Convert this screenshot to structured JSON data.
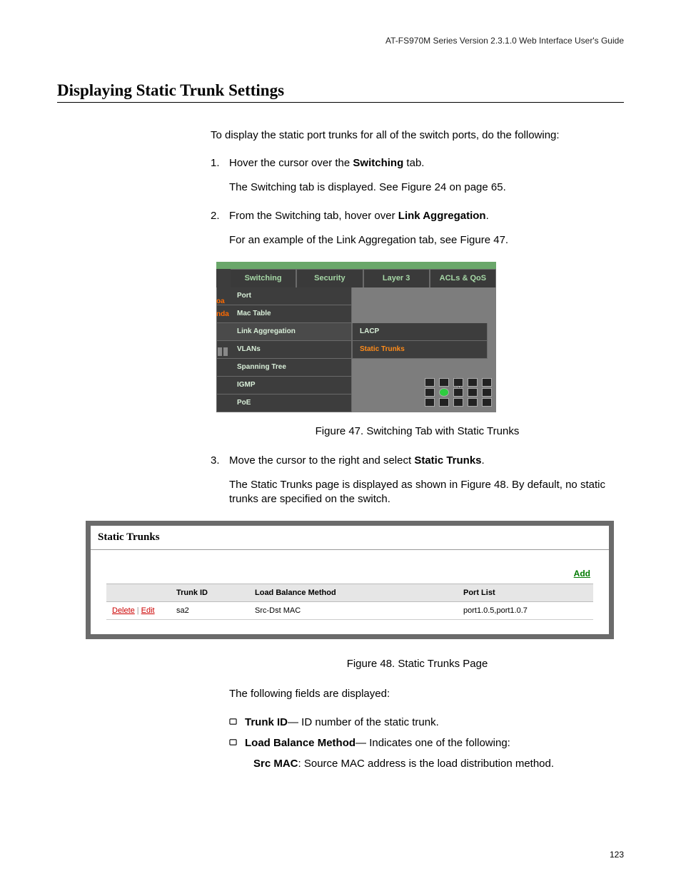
{
  "header": "AT-FS970M Series Version 2.3.1.0 Web Interface User's Guide",
  "section_title": "Displaying Static Trunk Settings",
  "intro": "To display the static port trunks for all of the switch ports, do the following:",
  "step1_pre": "Hover the cursor over the ",
  "step1_bold": "Switching",
  "step1_post": " tab.",
  "step1_note": "The Switching tab is displayed. See Figure 24 on page 65.",
  "step2_pre": "From the Switching tab, hover over ",
  "step2_bold": "Link Aggregation",
  "step2_post": ".",
  "step2_note": "For an example of the Link Aggregation tab, see Figure 47.",
  "fig47": {
    "tabs": {
      "switching": "Switching",
      "security": "Security",
      "layer3": "Layer 3",
      "acls": "ACLs & QoS"
    },
    "menu": {
      "port": "Port",
      "mac": "Mac Table",
      "linkagg": "Link Aggregation",
      "vlans": "VLANs",
      "spanning": "Spanning Tree",
      "igmp": "IGMP",
      "poe": "PoE"
    },
    "sub": {
      "lacp": "LACP",
      "static": "Static Trunks"
    },
    "edge1": "oa",
    "edge2": "nda"
  },
  "fig47_caption": "Figure 47. Switching Tab with Static Trunks",
  "step3_pre": "Move the cursor to the right and select ",
  "step3_bold": "Static Trunks",
  "step3_post": ".",
  "step3_note": "The Static Trunks page is displayed as shown in Figure 48. By default, no static trunks are specified on the switch.",
  "fig48": {
    "title": "Static Trunks",
    "add": "Add",
    "headers": {
      "actions": "",
      "trunkid": "Trunk ID",
      "lbmethod": "Load Balance Method",
      "portlist": "Port List"
    },
    "actions": {
      "delete": "Delete",
      "edit": "Edit"
    },
    "row": {
      "trunkid": "sa2",
      "lbmethod": "Src-Dst MAC",
      "portlist": "port1.0.5,port1.0.7"
    }
  },
  "fig48_caption": "Figure 48. Static Trunks Page",
  "fields_intro": "The following fields are displayed:",
  "field1_label": "Trunk ID",
  "field1_desc": "— ID number of the static trunk.",
  "field2_label": "Load Balance Method",
  "field2_desc": "— Indicates one of the following:",
  "srcmac_label": "Src MAC",
  "srcmac_desc": ": Source MAC address is the load distribution method.",
  "page_number": "123"
}
